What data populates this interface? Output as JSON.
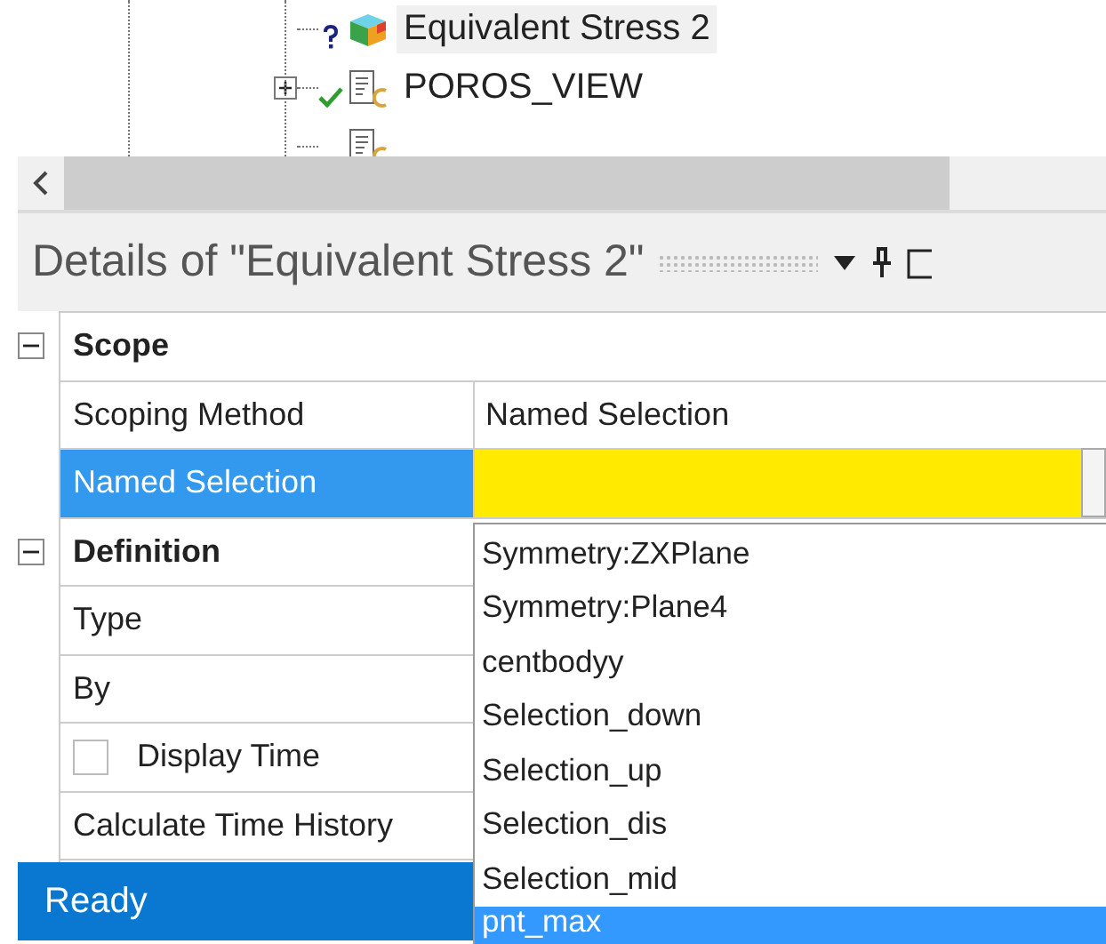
{
  "tree": {
    "items": [
      {
        "kind": "pending-result",
        "label": "Equivalent Stress 2",
        "selected": true
      },
      {
        "kind": "solved-document",
        "label": "POROS_VIEW",
        "selected": false,
        "expanded": false
      }
    ]
  },
  "details": {
    "title": "Details of \"Equivalent Stress 2\"",
    "groups": [
      {
        "name": "Scope",
        "expanded": true,
        "rows": [
          {
            "kind": "text",
            "label": "Scoping Method",
            "value": "Named Selection",
            "selected": false
          },
          {
            "kind": "combo",
            "label": "Named Selection",
            "selected": true
          }
        ]
      },
      {
        "name": "Definition",
        "expanded": true,
        "rows": [
          {
            "kind": "text",
            "label": "Type",
            "selected": false
          },
          {
            "kind": "text",
            "label": "By",
            "selected": false
          },
          {
            "kind": "checkbox",
            "label": "Display Time",
            "checked": false,
            "selected": false
          },
          {
            "kind": "text",
            "label": "Calculate Time History",
            "selected": false
          },
          {
            "kind": "text",
            "selected": false
          }
        ]
      }
    ]
  },
  "dropdown": {
    "items": [
      {
        "label": "Symmetry:ZXPlane",
        "selected": false
      },
      {
        "label": "Symmetry:Plane4",
        "selected": false
      },
      {
        "label": "centbodyy",
        "selected": false
      },
      {
        "label": "Selection_down",
        "selected": false
      },
      {
        "label": "Selection_up",
        "selected": false
      },
      {
        "label": "Selection_dis",
        "selected": false
      },
      {
        "label": "Selection_mid",
        "selected": false
      },
      {
        "label": "pnt_max",
        "selected": true
      }
    ]
  },
  "status_bar": {
    "text": "Ready"
  }
}
